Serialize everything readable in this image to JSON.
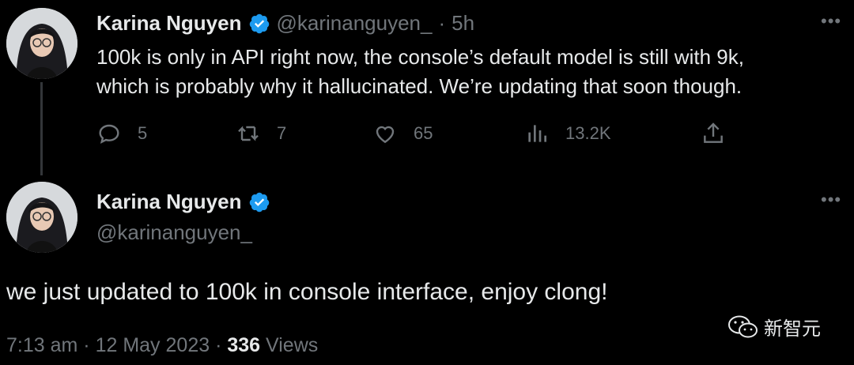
{
  "colors": {
    "background": "#000000",
    "text": "#e7e9ea",
    "muted": "#71767b",
    "verified": "#1d9bf0"
  },
  "reply_tweet": {
    "author_name": "Karina Nguyen",
    "handle": "@karinanguyen_",
    "separator": "·",
    "age": "5h",
    "text_line1": "100k is only in API right now, the console’s default model is still with 9k,",
    "text_line2": "which is probably why it hallucinated. We’re updating that soon though.",
    "actions": {
      "replies": "5",
      "retweets": "7",
      "likes": "65",
      "views": "13.2K"
    },
    "icons": [
      "reply-icon",
      "retweet-icon",
      "like-icon",
      "views-icon",
      "share-icon"
    ]
  },
  "main_tweet": {
    "author_name": "Karina Nguyen",
    "handle": "@karinanguyen_",
    "text": "we just updated to 100k in console interface, enjoy clong!",
    "time": "7:13 am",
    "dot1": "·",
    "date": "12 May 2023",
    "dot2": "·",
    "views_count": "336",
    "views_label": "Views"
  },
  "watermark": {
    "text": "新智元",
    "icon": "wechat-icon"
  }
}
